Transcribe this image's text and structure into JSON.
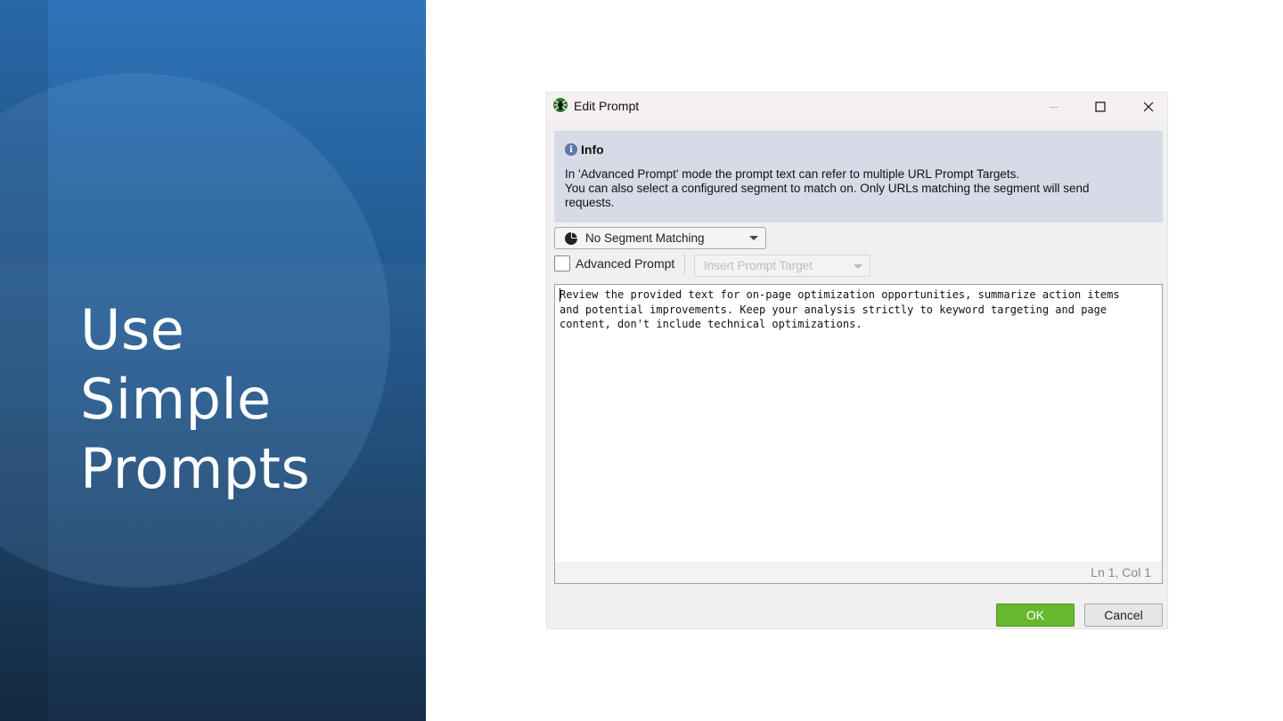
{
  "slide": {
    "title_lines": [
      "Use",
      "Simple",
      "Prompts"
    ]
  },
  "dialog": {
    "title": "Edit Prompt",
    "app_icon": "spider-icon",
    "window_controls": [
      "minimize",
      "maximize",
      "close"
    ],
    "info": {
      "heading": "Info",
      "lines": [
        "In 'Advanced Prompt' mode the prompt text can refer to multiple URL Prompt Targets.",
        "You can also select a configured segment to match on. Only URLs matching the segment will send",
        "requests."
      ]
    },
    "segment_dropdown": {
      "selected": "No Segment Matching",
      "icon": "pie-chart-icon"
    },
    "advanced_prompt": {
      "label": "Advanced Prompt",
      "checked": false
    },
    "insert_target": {
      "label": "Insert Prompt Target",
      "disabled": true
    },
    "editor": {
      "lines": [
        "Review the provided text for on-page optimization opportunities, summarize action items",
        "and potential improvements. Keep your analysis strictly to keyword targeting and page",
        "content, don't include technical optimizations."
      ],
      "status": "Ln 1, Col 1"
    },
    "buttons": {
      "ok": "OK",
      "cancel": "Cancel"
    },
    "colors": {
      "ok_green": "#68b82f",
      "info_bg": "#d6dbe7",
      "slide_blue": "#2e74b9"
    }
  }
}
